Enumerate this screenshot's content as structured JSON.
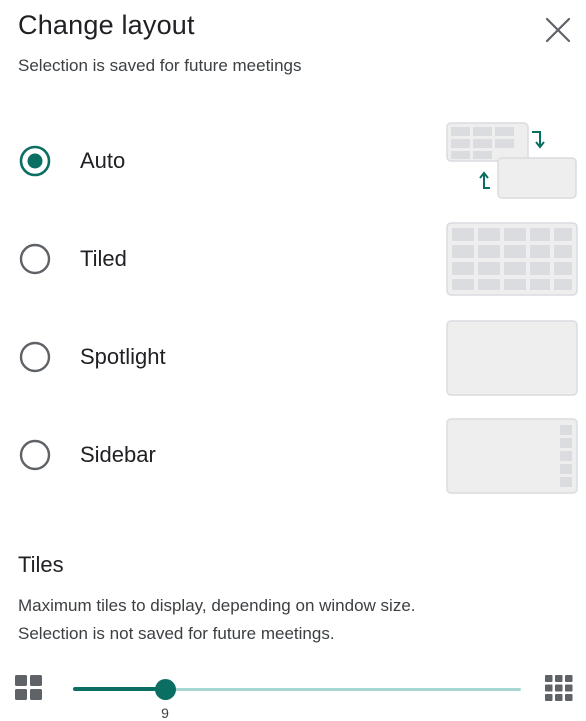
{
  "dialog": {
    "title": "Change layout",
    "subtitle": "Selection is saved for future meetings",
    "close_icon": "close-icon"
  },
  "layouts": [
    {
      "label": "Auto",
      "selected": true,
      "thumbnail": "auto-layout-thumbnail"
    },
    {
      "label": "Tiled",
      "selected": false,
      "thumbnail": "tiled-layout-thumbnail"
    },
    {
      "label": "Spotlight",
      "selected": false,
      "thumbnail": "spotlight-layout-thumbnail"
    },
    {
      "label": "Sidebar",
      "selected": false,
      "thumbnail": "sidebar-layout-thumbnail"
    }
  ],
  "tiles": {
    "title": "Tiles",
    "description_line1": "Maximum tiles to display, depending on window size.",
    "description_line2": "Selection is not saved for future meetings.",
    "slider_value": "9",
    "min_icon": "grid-small-icon",
    "max_icon": "grid-large-icon"
  },
  "colors": {
    "accent": "#0b6e63",
    "track_inactive": "#a7d5cf",
    "thumbnail_fill": "#eeeeee",
    "thumbnail_border": "#dadce0"
  }
}
